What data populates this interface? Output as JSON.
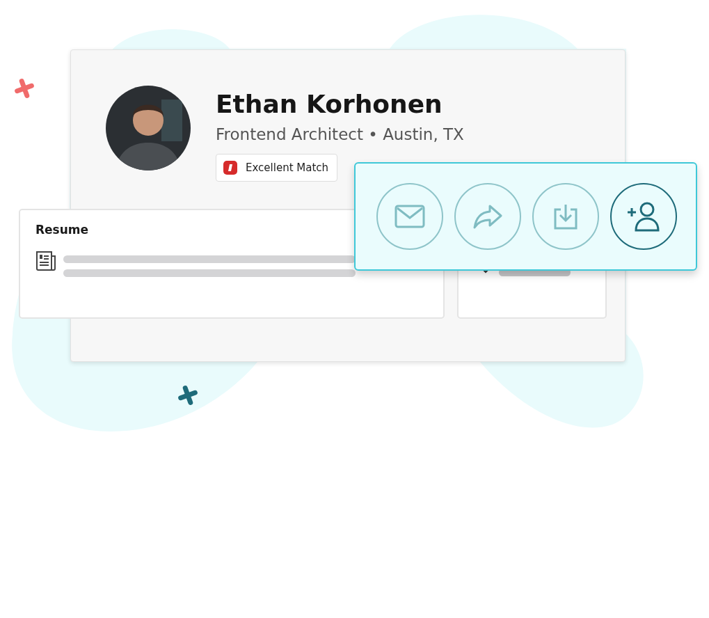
{
  "profile": {
    "name": "Ethan Korhonen",
    "subtitle": "Frontend Architect • Austin, TX",
    "badge": {
      "label": "Excellent Match"
    }
  },
  "resume": {
    "title": "Resume"
  },
  "actions": [
    {
      "kind": "mail",
      "selected": false
    },
    {
      "kind": "share",
      "selected": false
    },
    {
      "kind": "download",
      "selected": false
    },
    {
      "kind": "add-user",
      "selected": true
    }
  ]
}
